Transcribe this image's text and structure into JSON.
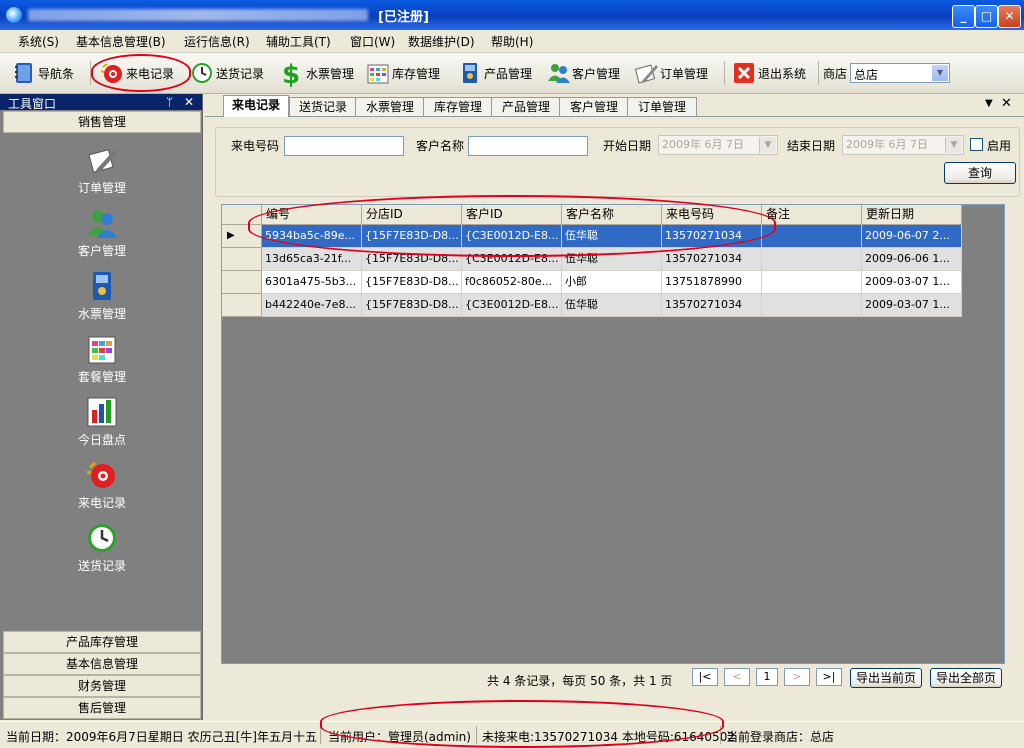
{
  "window": {
    "title_suffix": "[已注册]"
  },
  "menu": [
    "系统(S)",
    "基本信息管理(B)",
    "运行信息(R)",
    "辅助工具(T)",
    "窗口(W)",
    "数据维护(D)",
    "帮助(H)"
  ],
  "toolbar": {
    "nav_label": "导航条",
    "calls_label": "来电记录",
    "delivery_label": "送货记录",
    "water_label": "水票管理",
    "stock_label": "库存管理",
    "product_label": "产品管理",
    "customer_label": "客户管理",
    "order_label": "订单管理",
    "exit_label": "退出系统",
    "shop_label": "商店",
    "shop_value": "总店"
  },
  "left_panel": {
    "title": "工具窗口",
    "pin": "ᛘ",
    "close": "✕",
    "top_header": "销售管理",
    "nav_items": [
      "订单管理",
      "客户管理",
      "水票管理",
      "套餐管理",
      "今日盘点",
      "来电记录",
      "送货记录"
    ],
    "bottom_headers": [
      "产品库存管理",
      "基本信息管理",
      "财务管理",
      "售后管理"
    ]
  },
  "tabs": [
    "来电记录",
    "送货记录",
    "水票管理",
    "库存管理",
    "产品管理",
    "客户管理",
    "订单管理"
  ],
  "filters": {
    "phone_label": "来电号码",
    "phone_value": "",
    "customer_label": "客户名称",
    "customer_value": "",
    "start_label": "开始日期",
    "start_value": "2009年 6月 7日",
    "end_label": "结束日期",
    "end_value": "2009年 6月 7日",
    "enable_label": "启用",
    "query_button": "查询"
  },
  "grid": {
    "columns": [
      "编号",
      "分店ID",
      "客户ID",
      "客户名称",
      "来电号码",
      "备注",
      "更新日期"
    ],
    "rows": [
      [
        "5934ba5c-89e...",
        "{15F7E83D-D8...",
        "{C3E0012D-E8...",
        "伍华聪",
        "13570271034",
        "",
        "2009-06-07 2..."
      ],
      [
        "13d65ca3-21f...",
        "{15F7E83D-D8...",
        "{C3E0012D-E8...",
        "伍华聪",
        "13570271034",
        "",
        "2009-06-06 1..."
      ],
      [
        "6301a475-5b3...",
        "{15F7E83D-D8...",
        "f0c86052-80e...",
        "小郎",
        "13751878990",
        "",
        "2009-03-07 1..."
      ],
      [
        "b442240e-7e8...",
        "{15F7E83D-D8...",
        "{C3E0012D-E8...",
        "伍华聪",
        "13570271034",
        "",
        "2009-03-07 1..."
      ]
    ],
    "current_row_marker": "▶"
  },
  "pager": {
    "summary": "共 4 条记录，每页 50 条，共 1 页",
    "first": "|<",
    "prev": "<",
    "page": "1",
    "next": ">",
    "last": ">|",
    "export_current": "导出当前页",
    "export_all": "导出全部页"
  },
  "status": {
    "date": "当前日期：2009年6月7日星期日 农历己丑[牛]年五月十五",
    "user": "当前用户：管理员(admin)",
    "missed": "未接来电:13570271034 本地号码:61640502",
    "shop": "当前登录商店：总店"
  },
  "colors": {
    "titlebar": "#0A5BE0",
    "selection": "#316AC5",
    "highlight_circle": "#E0001A",
    "panel_bg": "#808080"
  }
}
